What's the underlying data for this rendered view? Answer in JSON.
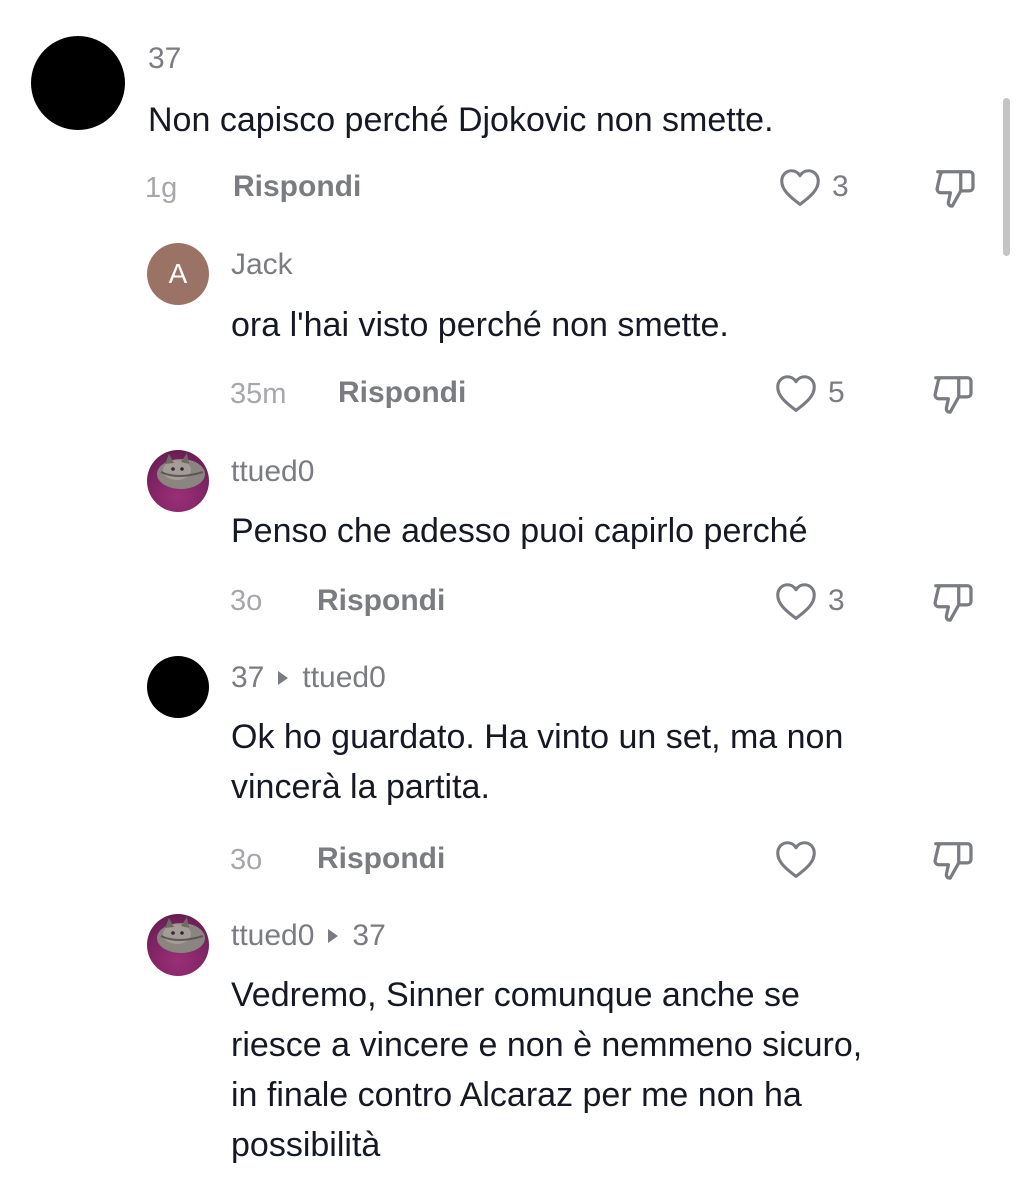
{
  "comments": [
    {
      "username": "37",
      "text": "Non capisco perché Djokovic non smette.",
      "time": "1g",
      "reply_label": "Rispondi",
      "likes": "3",
      "avatar_icon": "black-avatar"
    },
    {
      "username": "Jack",
      "avatar_letter": "A",
      "text": "ora l'hai visto perché non smette.",
      "time": "35m",
      "reply_label": "Rispondi",
      "likes": "5",
      "avatar_color": "#9a7366"
    },
    {
      "username": "ttued0",
      "text": "Penso che adesso puoi capirlo perché",
      "time": "3o",
      "reply_label": "Rispondi",
      "likes": "3",
      "avatar_icon": "cat-photo-avatar"
    },
    {
      "username": "37",
      "reply_to": "ttued0",
      "text_lines": [
        "Ok ho guardato. Ha vinto un set, ma non",
        "vincerà la partita."
      ],
      "time": "3o",
      "reply_label": "Rispondi",
      "likes": "",
      "avatar_icon": "black-avatar"
    },
    {
      "username": "ttued0",
      "reply_to": "37",
      "text_lines": [
        "Vedremo, Sinner comunque anche se",
        "riesce a vincere e non è nemmeno sicuro,",
        "in finale contro Alcaraz per me non ha",
        "possibilità"
      ],
      "avatar_icon": "cat-photo-avatar"
    }
  ],
  "icons": {
    "like": "heart-outline-icon",
    "dislike": "thumbs-down-outline-icon",
    "reply_arrow": "triangle-right-icon"
  },
  "colors": {
    "text": "#161823",
    "muted": "#7b7c82",
    "timestamp": "#a6a7ab",
    "scrollbar": "#c4c4c6"
  }
}
